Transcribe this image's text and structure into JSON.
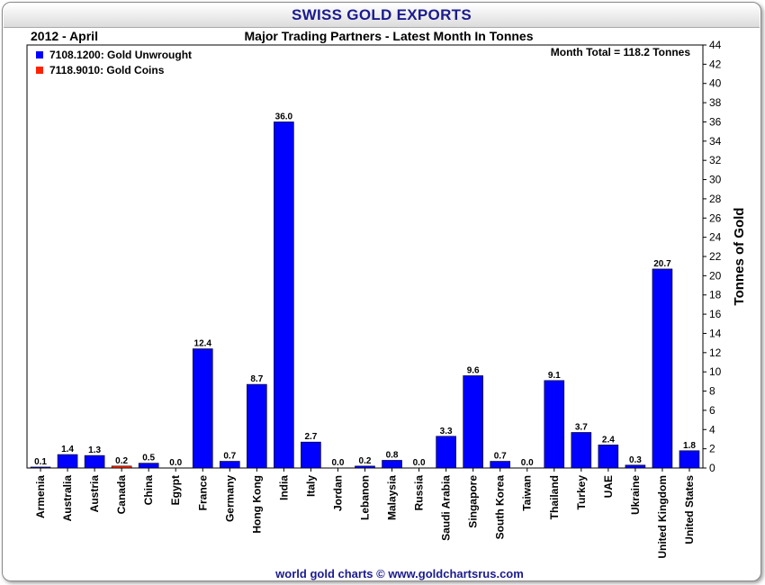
{
  "title": "SWISS GOLD EXPORTS",
  "period": "2012 - April",
  "subtitle": "Major Trading Partners - Latest Month In Tonnes",
  "month_total": "Month Total = 118.2 Tonnes",
  "footer": "world gold charts © www.goldchartsrus.com",
  "colors": {
    "unwrought": "#0000ff",
    "coins": "#ff2200",
    "title": "#1b1b8f",
    "footer": "#1b1b8f"
  },
  "chart_data": {
    "type": "bar",
    "title": "SWISS GOLD EXPORTS",
    "subtitle": "Major Trading Partners - Latest Month In Tonnes",
    "ylabel": "Tonnes of Gold",
    "ylim": [
      0,
      44
    ],
    "ytick_step": 2,
    "y_axis_side": "right",
    "legend_position": "top-left",
    "grid": false,
    "categories": [
      "Armenia",
      "Australia",
      "Austria",
      "Canada",
      "China",
      "Egypt",
      "France",
      "Germany",
      "Hong Kong",
      "India",
      "Italy",
      "Jordan",
      "Lebanon",
      "Malaysia",
      "Russia",
      "Saudi Arabia",
      "Singapore",
      "South Korea",
      "Taiwan",
      "Thailand",
      "Turkey",
      "UAE",
      "Ukraine",
      "United Kingdom",
      "United States"
    ],
    "series": [
      {
        "name": "7108.1200: Gold Unwrought",
        "color": "#0000ff",
        "values": [
          0.1,
          1.4,
          1.3,
          0,
          0.5,
          0.0,
          12.4,
          0.7,
          8.7,
          36.0,
          2.7,
          0.0,
          0.2,
          0.8,
          0.0,
          3.3,
          9.6,
          0.7,
          0.0,
          9.1,
          3.7,
          2.4,
          0.3,
          20.7,
          1.8
        ]
      },
      {
        "name": "7118.9010: Gold Coins",
        "color": "#ff2200",
        "values": [
          0,
          0,
          0,
          0.2,
          0,
          0,
          0,
          0,
          0,
          0,
          0,
          0,
          0,
          0,
          0,
          0,
          0,
          0,
          0,
          0,
          0,
          0,
          0,
          0,
          0
        ]
      }
    ],
    "data_labels": [
      "0.1",
      "1.4",
      "1.3",
      "0.2",
      "0.5",
      "0.0",
      "12.4",
      "0.7",
      "8.7",
      "36.0",
      "2.7",
      "0.0",
      "0.2",
      "0.8",
      "0.0",
      "3.3",
      "9.6",
      "0.7",
      "0.0",
      "9.1",
      "3.7",
      "2.4",
      "0.3",
      "20.7",
      "1.8"
    ]
  }
}
